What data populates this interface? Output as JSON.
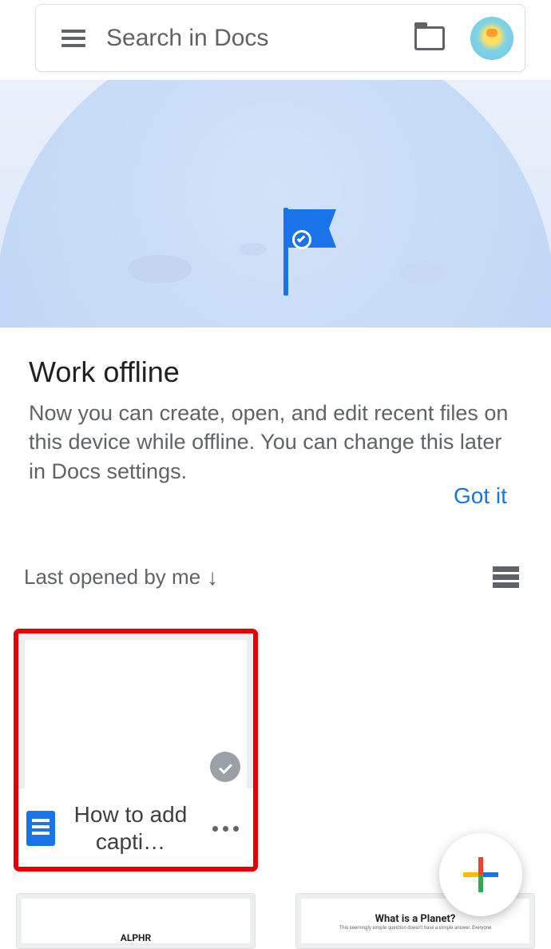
{
  "search": {
    "placeholder": "Search in Docs"
  },
  "banner": {
    "title": "Work offline",
    "body": "Now you can create, open, and edit recent files on this device while offline. You can change this later in Docs settings.",
    "dismiss": "Got it"
  },
  "sort": {
    "label": "Last opened by me"
  },
  "documents": [
    {
      "title": "How to add capti…",
      "offline_available": true,
      "highlighted": true
    },
    {
      "title": "ALPHR"
    },
    {
      "title": "What is a Planet?",
      "subtitle": "This seemingly simple question doesn't have a simple answer. Everyone"
    }
  ],
  "icons": {
    "menu": "menu-icon",
    "folder": "folder-icon",
    "avatar": "avatar",
    "list_view": "list-view-icon",
    "more": "more-icon",
    "fab": "plus-icon",
    "docs_app": "docs-app-icon",
    "offline_badge": "offline-check-icon",
    "sort_arrow": "arrow-down-icon"
  }
}
